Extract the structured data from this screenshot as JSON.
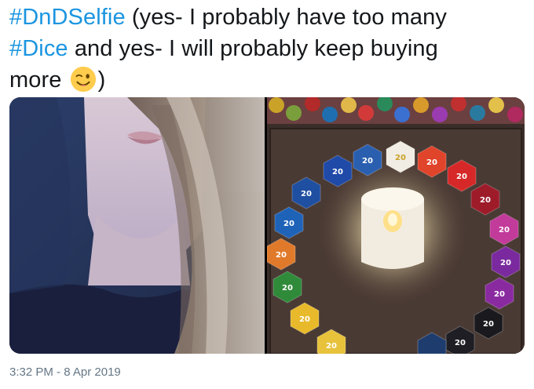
{
  "tweet": {
    "hashtag_1": "#DnDSelfie",
    "text_1": " (yes- I probably have too many",
    "hashtag_2": "#Dice",
    "text_2": " and yes- I will probably keep buying",
    "text_3": "more",
    "emoji": "winking-face-icon",
    "text_4": ")"
  },
  "timestamp": "3:32 PM - 8 Apr 2019",
  "colors": {
    "hashtag": "#1b95e0",
    "text": "#14171a",
    "timestamp": "#657786"
  }
}
